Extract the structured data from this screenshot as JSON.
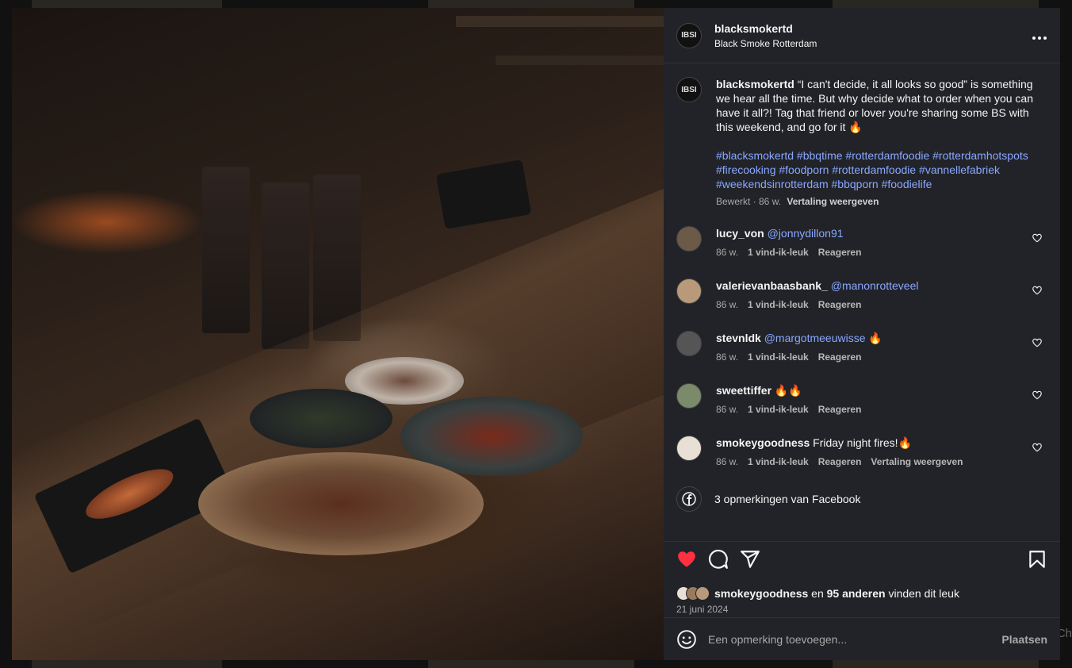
{
  "post": {
    "username": "blacksmokertd",
    "location": "Black Smoke Rotterdam",
    "avatar_text": "IBSI",
    "caption": "“I can't decide, it all looks so good” is something we hear all the time. But why decide what to order when you can have it all?! Tag that friend or lover you're sharing some BS with this weekend, and go for it 🔥",
    "hashtags": "#blacksmokertd #bbqtime #rotterdamfoodie #rotterdamhotspots #firecooking #foodporn #rotterdamfoodie #vannellefabriek #weekendsinrotterdam #bbqporn #foodielife",
    "edited": "Bewerkt · 86 w.",
    "translate": "Vertaling weergeven"
  },
  "comments": [
    {
      "user": "lucy_von",
      "mention": "@jonnydillon91",
      "text": "",
      "age": "86 w.",
      "likes": "1 vind-ik-leuk",
      "reply": "Reageren",
      "translate": "",
      "avatar_color": "#6b5a48"
    },
    {
      "user": "valerievanbaasbank_",
      "mention": "@manonrotteveel",
      "text": "",
      "age": "86 w.",
      "likes": "1 vind-ik-leuk",
      "reply": "Reageren",
      "translate": "",
      "avatar_color": "#b89a7a"
    },
    {
      "user": "stevnldk",
      "mention": "@margotmeeuwisse",
      "text": " 🔥",
      "age": "86 w.",
      "likes": "1 vind-ik-leuk",
      "reply": "Reageren",
      "translate": "",
      "avatar_color": "#555555"
    },
    {
      "user": "sweettiffer",
      "mention": "",
      "text": " 🔥🔥",
      "age": "86 w.",
      "likes": "1 vind-ik-leuk",
      "reply": "Reageren",
      "translate": "",
      "avatar_color": "#7a8a6a"
    },
    {
      "user": "smokeygoodness",
      "mention": "",
      "text": " Friday night fires!🔥",
      "age": "86 w.",
      "likes": "1 vind-ik-leuk",
      "reply": "Reageren",
      "translate": "Vertaling weergeven",
      "avatar_color": "#e8e0d4"
    }
  ],
  "facebook": {
    "label": "3 opmerkingen van Facebook"
  },
  "likes": {
    "user": "smokeygoodness",
    "middle": " en ",
    "count": "95 anderen",
    "suffix": " vinden dit leuk"
  },
  "date": "21 juni 2024",
  "add_comment": {
    "placeholder": "Een opmerking toevoegen...",
    "post_label": "Plaatsen"
  },
  "edge_text": "Ch",
  "colors": {
    "accent_link": "#8aa7ff",
    "heart_red": "#ff3040",
    "panel_bg": "#212328"
  },
  "icons": [
    "more-icon",
    "heart-icon",
    "comment-icon",
    "share-icon",
    "bookmark-icon",
    "facebook-icon",
    "emoji-icon"
  ]
}
